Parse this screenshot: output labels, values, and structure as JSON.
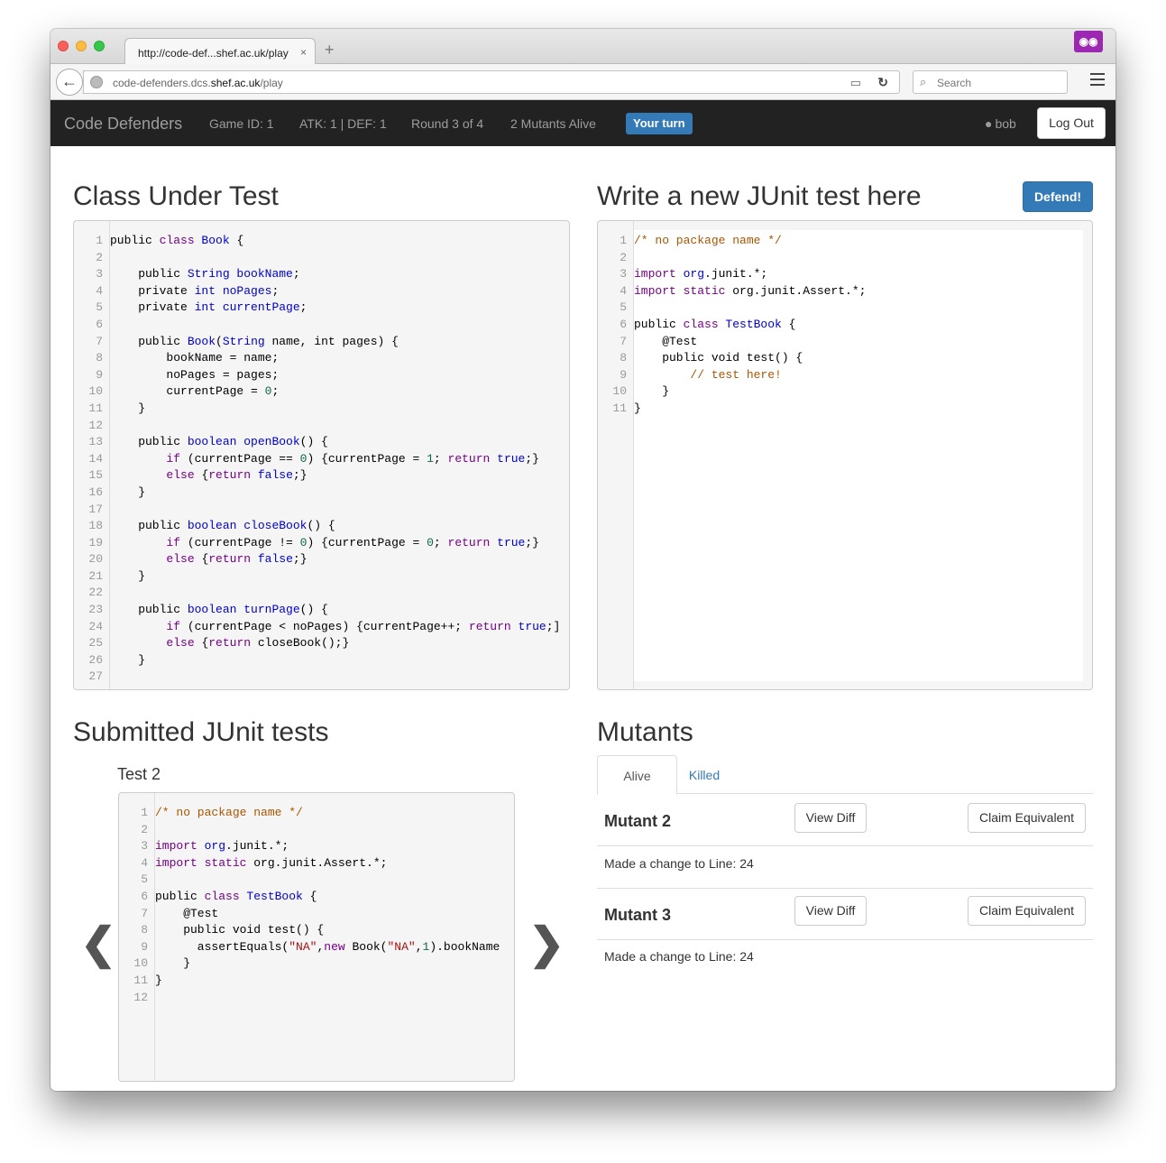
{
  "browser": {
    "tab_title": "http://code-def...shef.ac.uk/play",
    "tab_close": "×",
    "new_tab": "+",
    "url_prefix": "code-defenders.dcs.",
    "url_host": "shef.ac.uk",
    "url_path": "/play",
    "search_placeholder": "Search"
  },
  "appnav": {
    "brand": "Code Defenders",
    "game_id": "Game ID: 1",
    "score": "ATK: 1 | DEF: 1",
    "round": "Round 3 of 4",
    "mutants_alive": "2 Mutants Alive",
    "turn_badge": "Your turn",
    "user": "bob",
    "logout": "Log Out"
  },
  "cut": {
    "heading": "Class Under Test"
  },
  "editor": {
    "heading": "Write a new JUnit test here",
    "defend_button": "Defend!"
  },
  "submitted": {
    "heading": "Submitted JUnit tests",
    "test_title": "Test 2",
    "prev": "❮",
    "next": "❯"
  },
  "mutants": {
    "heading": "Mutants",
    "tab_alive": "Alive",
    "tab_killed": "Killed",
    "items": [
      {
        "title": "Mutant 2",
        "view_diff": "View Diff",
        "claim": "Claim Equivalent",
        "desc": "Made a change to Line: 24"
      },
      {
        "title": "Mutant 3",
        "view_diff": "View Diff",
        "claim": "Claim Equivalent",
        "desc": "Made a change to Line: 24"
      }
    ]
  },
  "code": {
    "class_under_test": [
      [
        [
          "",
          "public "
        ],
        [
          "k",
          "class "
        ],
        [
          "t",
          "Book"
        ],
        [
          "",
          " {"
        ]
      ],
      [],
      [
        [
          "",
          "    public "
        ],
        [
          "t",
          "String bookName"
        ],
        [
          "",
          ";"
        ]
      ],
      [
        [
          "",
          "    private "
        ],
        [
          "t",
          "int noPages"
        ],
        [
          "",
          ";"
        ]
      ],
      [
        [
          "",
          "    private "
        ],
        [
          "t",
          "int currentPage"
        ],
        [
          "",
          ";"
        ]
      ],
      [],
      [
        [
          "",
          "    public "
        ],
        [
          "t",
          "Book"
        ],
        [
          "",
          "("
        ],
        [
          "t",
          "String"
        ],
        [
          "",
          " name, int pages) {"
        ]
      ],
      [
        [
          "",
          "        bookName = name;"
        ]
      ],
      [
        [
          "",
          "        noPages = pages;"
        ]
      ],
      [
        [
          "",
          "        currentPage = "
        ],
        [
          "n",
          "0"
        ],
        [
          "",
          ";"
        ]
      ],
      [
        [
          "",
          "    }"
        ]
      ],
      [],
      [
        [
          "",
          "    public "
        ],
        [
          "t",
          "boolean openBook"
        ],
        [
          "",
          "() {"
        ]
      ],
      [
        [
          "",
          "        "
        ],
        [
          "k",
          "if"
        ],
        [
          "",
          " (currentPage == "
        ],
        [
          "n",
          "0"
        ],
        [
          "",
          ") {currentPage = "
        ],
        [
          "n",
          "1"
        ],
        [
          "",
          "; "
        ],
        [
          "k",
          "return"
        ],
        [
          "",
          " "
        ],
        [
          "t",
          "true"
        ],
        [
          "",
          ";}"
        ]
      ],
      [
        [
          "",
          "        "
        ],
        [
          "k",
          "else"
        ],
        [
          "",
          " {"
        ],
        [
          "k",
          "return"
        ],
        [
          "",
          " "
        ],
        [
          "t",
          "false"
        ],
        [
          "",
          ";}"
        ]
      ],
      [
        [
          "",
          "    }"
        ]
      ],
      [],
      [
        [
          "",
          "    public "
        ],
        [
          "t",
          "boolean closeBook"
        ],
        [
          "",
          "() {"
        ]
      ],
      [
        [
          "",
          "        "
        ],
        [
          "k",
          "if"
        ],
        [
          "",
          " (currentPage != "
        ],
        [
          "n",
          "0"
        ],
        [
          "",
          ") {currentPage = "
        ],
        [
          "n",
          "0"
        ],
        [
          "",
          "; "
        ],
        [
          "k",
          "return"
        ],
        [
          "",
          " "
        ],
        [
          "t",
          "true"
        ],
        [
          "",
          ";}"
        ]
      ],
      [
        [
          "",
          "        "
        ],
        [
          "k",
          "else"
        ],
        [
          "",
          " {"
        ],
        [
          "k",
          "return"
        ],
        [
          "",
          " "
        ],
        [
          "t",
          "false"
        ],
        [
          "",
          ";}"
        ]
      ],
      [
        [
          "",
          "    }"
        ]
      ],
      [],
      [
        [
          "",
          "    public "
        ],
        [
          "t",
          "boolean turnPage"
        ],
        [
          "",
          "() {"
        ]
      ],
      [
        [
          "",
          "        "
        ],
        [
          "k",
          "if"
        ],
        [
          "",
          " (currentPage < noPages) {currentPage++; "
        ],
        [
          "k",
          "return"
        ],
        [
          "",
          " "
        ],
        [
          "t",
          "true"
        ],
        [
          "",
          ";]"
        ]
      ],
      [
        [
          "",
          "        "
        ],
        [
          "k",
          "else"
        ],
        [
          "",
          " {"
        ],
        [
          "k",
          "return"
        ],
        [
          "",
          " closeBook();}"
        ]
      ],
      [
        [
          "",
          "    }"
        ]
      ],
      []
    ],
    "editor_test": [
      [
        [
          "c",
          "/* no package name */"
        ]
      ],
      [],
      [
        [
          "k",
          "import "
        ],
        [
          "t",
          "org"
        ],
        [
          "",
          ".junit.*;"
        ]
      ],
      [
        [
          "k",
          "import static "
        ],
        [
          "",
          "org.junit.Assert.*;"
        ]
      ],
      [],
      [
        [
          "",
          "public "
        ],
        [
          "k",
          "class "
        ],
        [
          "t",
          "TestBook"
        ],
        [
          "",
          " {"
        ]
      ],
      [
        [
          "",
          "    @Test"
        ]
      ],
      [
        [
          "",
          "    public void test() {"
        ]
      ],
      [
        [
          "c",
          "        // test here!"
        ]
      ],
      [
        [
          "",
          "    }"
        ]
      ],
      [
        [
          "",
          "}"
        ]
      ]
    ],
    "submitted_test": [
      [
        [
          "c",
          "/* no package name */"
        ]
      ],
      [],
      [
        [
          "k",
          "import "
        ],
        [
          "t",
          "org"
        ],
        [
          "",
          ".junit.*;"
        ]
      ],
      [
        [
          "k",
          "import static "
        ],
        [
          "",
          "org.junit.Assert.*;"
        ]
      ],
      [],
      [
        [
          "",
          "public "
        ],
        [
          "k",
          "class "
        ],
        [
          "t",
          "TestBook"
        ],
        [
          "",
          " {"
        ]
      ],
      [
        [
          "",
          "    @Test"
        ]
      ],
      [
        [
          "",
          "    public void test() {"
        ]
      ],
      [
        [
          "",
          "      assertEquals("
        ],
        [
          "s",
          "\"NA\""
        ],
        [
          "",
          ","
        ],
        [
          "k",
          "new"
        ],
        [
          "",
          " Book("
        ],
        [
          "s",
          "\"NA\""
        ],
        [
          "",
          ","
        ],
        [
          "n",
          "1"
        ],
        [
          "",
          ").bookName"
        ]
      ],
      [
        [
          "",
          "    }"
        ]
      ],
      [
        [
          "",
          "}"
        ]
      ],
      []
    ]
  }
}
